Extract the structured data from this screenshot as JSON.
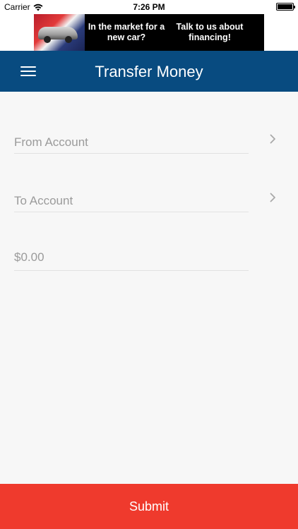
{
  "status_bar": {
    "carrier": "Carrier",
    "time": "7:26 PM"
  },
  "ad": {
    "line_1": "In the market for a new car?",
    "line_2": "Talk to us about financing!"
  },
  "nav": {
    "title": "Transfer Money",
    "menu_icon": "hamburger-menu-icon"
  },
  "form": {
    "from_account_label": "From Account",
    "to_account_label": "To Account",
    "amount_placeholder": "$0.00",
    "amount_value": ""
  },
  "submit": {
    "label": "Submit"
  },
  "colors": {
    "nav_background": "#084b80",
    "submit_background": "#ef3a2d",
    "page_background": "#f7f7f7",
    "placeholder_text": "#9b9b9b"
  }
}
